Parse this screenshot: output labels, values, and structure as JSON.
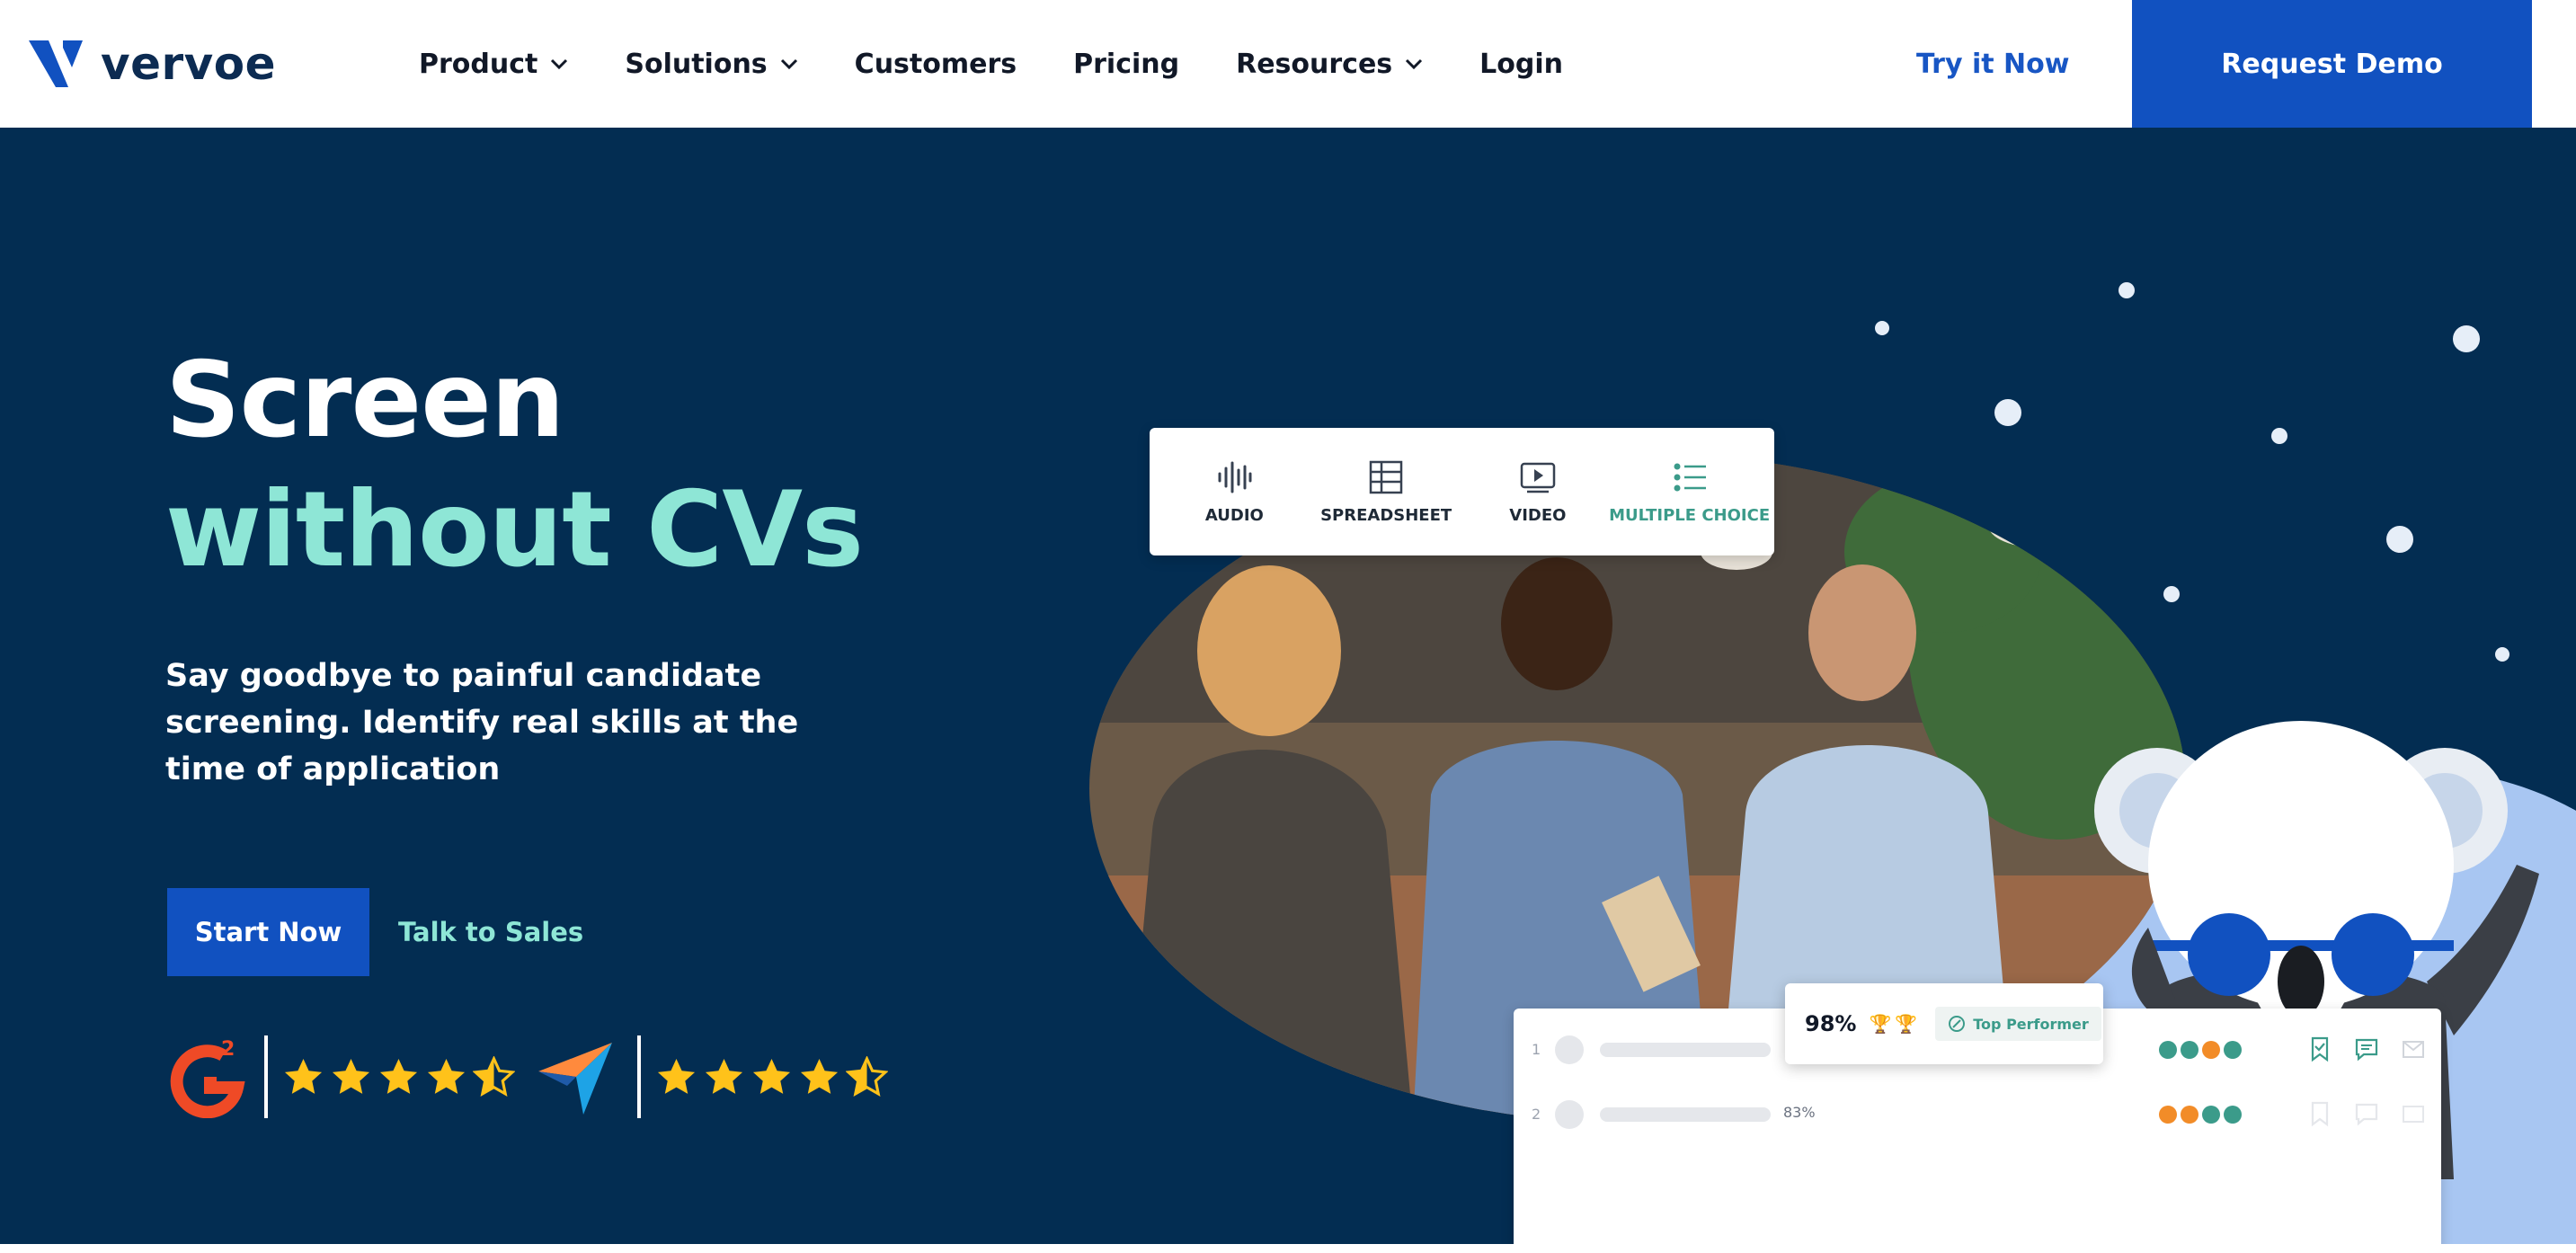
{
  "brand": {
    "name": "vervoe"
  },
  "nav": {
    "items": [
      {
        "label": "Product",
        "dropdown": true
      },
      {
        "label": "Solutions",
        "dropdown": true
      },
      {
        "label": "Customers",
        "dropdown": false
      },
      {
        "label": "Pricing",
        "dropdown": false
      },
      {
        "label": "Resources",
        "dropdown": true
      },
      {
        "label": "Login",
        "dropdown": false
      }
    ],
    "try_now": "Try it Now",
    "request_demo": "Request Demo"
  },
  "hero": {
    "headline_line1": "Screen",
    "headline_line2": "without CVs",
    "subtext": "Say goodbye to painful candidate screening. Identify real skills at the time of application",
    "cta_primary": "Start Now",
    "cta_secondary": "Talk to Sales",
    "ratings": [
      {
        "source": "g2-logo",
        "stars": 4.5
      },
      {
        "source": "capterra-logo",
        "stars": 4.5
      }
    ]
  },
  "assessment_types": [
    {
      "icon": "audio-icon",
      "label": "AUDIO"
    },
    {
      "icon": "spreadsheet-icon",
      "label": "SPREADSHEET"
    },
    {
      "icon": "video-icon",
      "label": "VIDEO"
    },
    {
      "icon": "multiple-choice-icon",
      "label": "MULTIPLE CHOICE"
    }
  ],
  "leaderboard": {
    "rows": [
      {
        "rank": "1",
        "score": "98%",
        "badge": "Top Performer"
      },
      {
        "rank": "2",
        "score": "83%"
      }
    ]
  },
  "colors": {
    "navy": "#032d52",
    "brand_blue": "#1151c0",
    "mint": "#8ee6d6",
    "teal": "#3b9b8a",
    "orange": "#f28c28",
    "star": "#ffc21a"
  }
}
